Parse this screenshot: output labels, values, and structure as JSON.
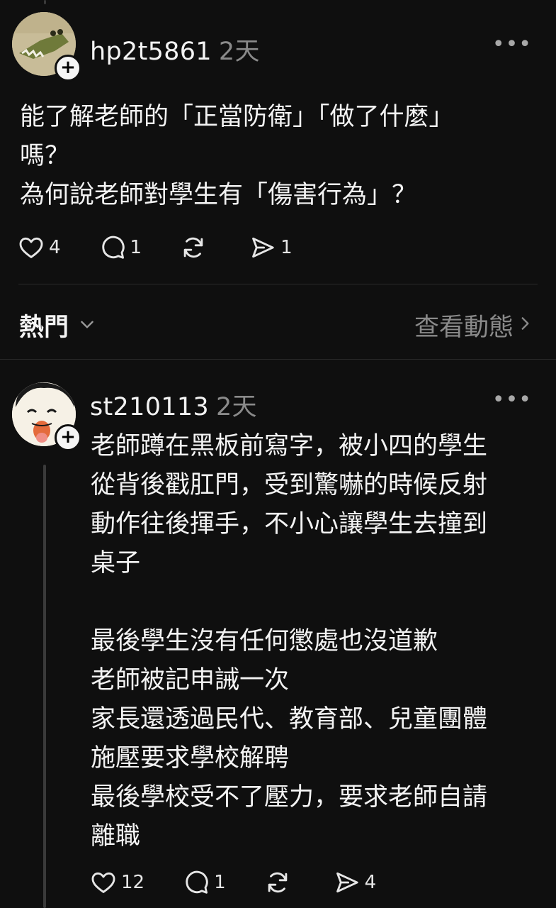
{
  "post1": {
    "username": "hp2t5861",
    "time": "2天",
    "body": "能了解老師的「正當防衛」「做了什麼」\n嗎？\n為何說老師對學生有「傷害行為」？",
    "likes": "4",
    "replies": "1",
    "shares": "1"
  },
  "sort": {
    "label": "熱門",
    "view_activity": "查看動態"
  },
  "post2": {
    "username": "st210113",
    "time": "2天",
    "body": "老師蹲在黑板前寫字，被小四的學生\n從背後戳肛門，受到驚嚇的時候反射\n動作往後揮手，不小心讓學生去撞到\n桌子\n\n最後學生沒有任何懲處也沒道歉\n老師被記申誡一次\n家長還透過民代、教育部、兒童團體\n施壓要求學校解聘\n最後學校受不了壓力，要求老師自請\n離職",
    "likes": "12",
    "replies": "1",
    "shares": "4"
  },
  "icons": {
    "like": "heart-icon",
    "reply": "comment-icon",
    "repost": "repost-icon",
    "share": "send-icon",
    "more": "more-icon",
    "follow": "plus-icon"
  }
}
